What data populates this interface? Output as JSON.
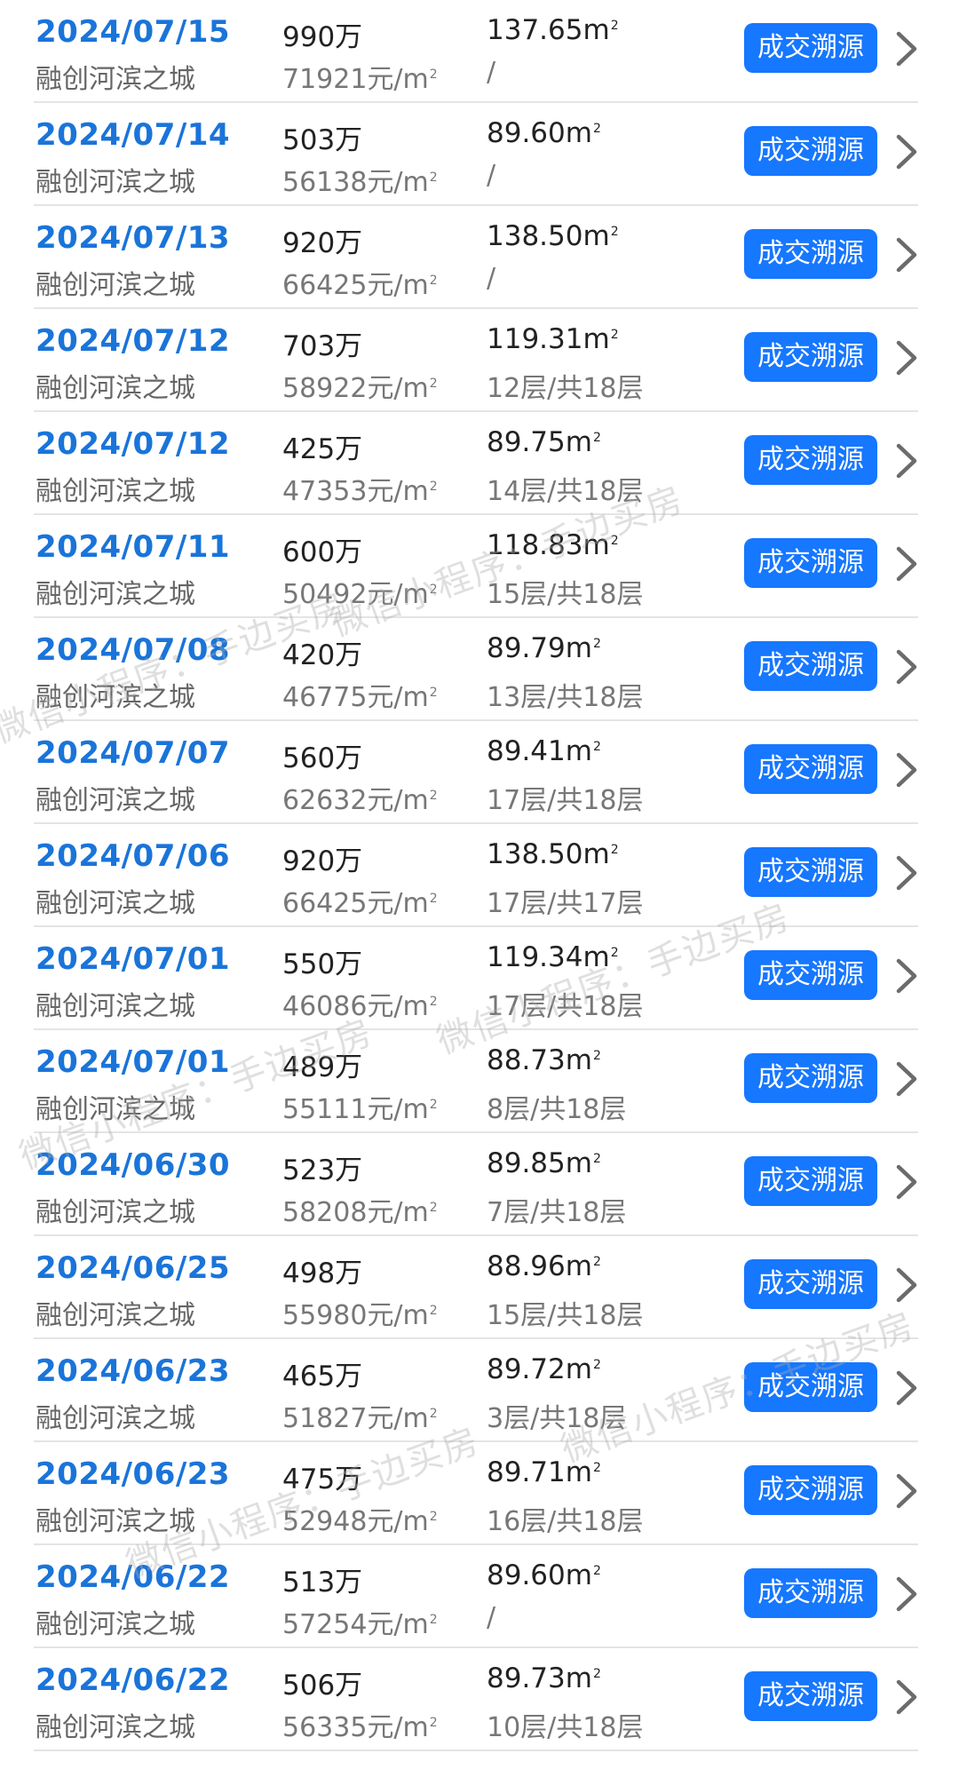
{
  "button_label": "成交溯源",
  "unit_suffix": "元/m",
  "area_unit": "m",
  "colors": {
    "date": "#1a74d9",
    "button": "#1677ff"
  },
  "watermark": "微信小程序：手边买房",
  "rows": [
    {
      "date": "2024/07/15",
      "community": "融创河滨之城",
      "price": "990万",
      "unit_price": "71921",
      "area": "137.65",
      "floor": "/"
    },
    {
      "date": "2024/07/14",
      "community": "融创河滨之城",
      "price": "503万",
      "unit_price": "56138",
      "area": "89.60",
      "floor": "/"
    },
    {
      "date": "2024/07/13",
      "community": "融创河滨之城",
      "price": "920万",
      "unit_price": "66425",
      "area": "138.50",
      "floor": "/"
    },
    {
      "date": "2024/07/12",
      "community": "融创河滨之城",
      "price": "703万",
      "unit_price": "58922",
      "area": "119.31",
      "floor": "12层/共18层"
    },
    {
      "date": "2024/07/12",
      "community": "融创河滨之城",
      "price": "425万",
      "unit_price": "47353",
      "area": "89.75",
      "floor": "14层/共18层"
    },
    {
      "date": "2024/07/11",
      "community": "融创河滨之城",
      "price": "600万",
      "unit_price": "50492",
      "area": "118.83",
      "floor": "15层/共18层"
    },
    {
      "date": "2024/07/08",
      "community": "融创河滨之城",
      "price": "420万",
      "unit_price": "46775",
      "area": "89.79",
      "floor": "13层/共18层"
    },
    {
      "date": "2024/07/07",
      "community": "融创河滨之城",
      "price": "560万",
      "unit_price": "62632",
      "area": "89.41",
      "floor": "17层/共18层"
    },
    {
      "date": "2024/07/06",
      "community": "融创河滨之城",
      "price": "920万",
      "unit_price": "66425",
      "area": "138.50",
      "floor": "17层/共17层"
    },
    {
      "date": "2024/07/01",
      "community": "融创河滨之城",
      "price": "550万",
      "unit_price": "46086",
      "area": "119.34",
      "floor": "17层/共18层"
    },
    {
      "date": "2024/07/01",
      "community": "融创河滨之城",
      "price": "489万",
      "unit_price": "55111",
      "area": "88.73",
      "floor": "8层/共18层"
    },
    {
      "date": "2024/06/30",
      "community": "融创河滨之城",
      "price": "523万",
      "unit_price": "58208",
      "area": "89.85",
      "floor": "7层/共18层"
    },
    {
      "date": "2024/06/25",
      "community": "融创河滨之城",
      "price": "498万",
      "unit_price": "55980",
      "area": "88.96",
      "floor": "15层/共18层"
    },
    {
      "date": "2024/06/23",
      "community": "融创河滨之城",
      "price": "465万",
      "unit_price": "51827",
      "area": "89.72",
      "floor": "3层/共18层"
    },
    {
      "date": "2024/06/23",
      "community": "融创河滨之城",
      "price": "475万",
      "unit_price": "52948",
      "area": "89.71",
      "floor": "16层/共18层"
    },
    {
      "date": "2024/06/22",
      "community": "融创河滨之城",
      "price": "513万",
      "unit_price": "57254",
      "area": "89.60",
      "floor": "/"
    },
    {
      "date": "2024/06/22",
      "community": "融创河滨之城",
      "price": "506万",
      "unit_price": "56335",
      "area": "89.73",
      "floor": "10层/共18层"
    }
  ]
}
